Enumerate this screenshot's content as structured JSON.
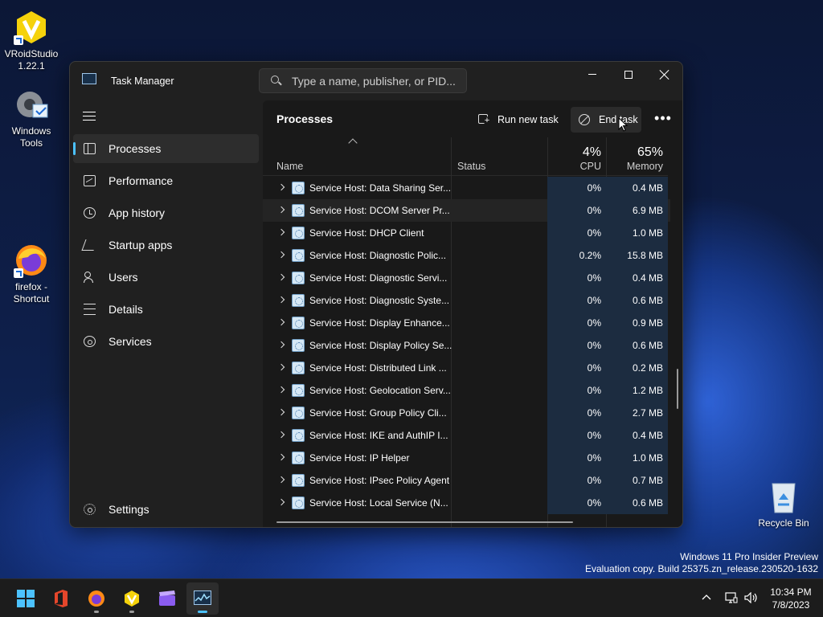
{
  "desktop": {
    "icons": [
      {
        "label": "VRoidStudio 1.22.1",
        "icon": "vroid-studio-icon"
      },
      {
        "label": "Windows Tools",
        "icon": "windows-tools-icon"
      },
      {
        "label": "firefox - Shortcut",
        "icon": "firefox-icon"
      },
      {
        "label": "Recycle Bin",
        "icon": "recycle-bin-icon"
      }
    ],
    "watermark_line1": "Windows 11 Pro Insider Preview",
    "watermark_line2": "Evaluation copy. Build 25375.zn_release.230520-1632"
  },
  "window": {
    "title": "Task Manager",
    "search_placeholder": "Type a name, publisher, or PID...",
    "controls": {
      "minimize": "minimize-icon",
      "maximize": "maximize-icon",
      "close": "close-icon"
    }
  },
  "sidebar": {
    "items": [
      {
        "label": "Processes",
        "icon": "processes-icon",
        "active": true
      },
      {
        "label": "Performance",
        "icon": "performance-icon"
      },
      {
        "label": "App history",
        "icon": "app-history-icon"
      },
      {
        "label": "Startup apps",
        "icon": "startup-apps-icon"
      },
      {
        "label": "Users",
        "icon": "users-icon"
      },
      {
        "label": "Details",
        "icon": "details-icon"
      },
      {
        "label": "Services",
        "icon": "services-icon"
      }
    ],
    "settings_label": "Settings"
  },
  "toolbar": {
    "title": "Processes",
    "run_new_task": "Run new task",
    "end_task": "End task",
    "more": "•••"
  },
  "table": {
    "columns": {
      "name": "Name",
      "status": "Status",
      "cpu": "CPU",
      "memory": "Memory"
    },
    "cpu_total": "4%",
    "memory_total": "65%",
    "rows": [
      {
        "name": "Service Host: Data Sharing Ser...",
        "status": "",
        "cpu": "0%",
        "memory": "0.4 MB"
      },
      {
        "name": "Service Host: DCOM Server Pr...",
        "status": "",
        "cpu": "0%",
        "memory": "6.9 MB"
      },
      {
        "name": "Service Host: DHCP Client",
        "status": "",
        "cpu": "0%",
        "memory": "1.0 MB"
      },
      {
        "name": "Service Host: Diagnostic Polic...",
        "status": "",
        "cpu": "0.2%",
        "memory": "15.8 MB"
      },
      {
        "name": "Service Host: Diagnostic Servi...",
        "status": "",
        "cpu": "0%",
        "memory": "0.4 MB"
      },
      {
        "name": "Service Host: Diagnostic Syste...",
        "status": "",
        "cpu": "0%",
        "memory": "0.6 MB"
      },
      {
        "name": "Service Host: Display Enhance...",
        "status": "",
        "cpu": "0%",
        "memory": "0.9 MB"
      },
      {
        "name": "Service Host: Display Policy Se...",
        "status": "",
        "cpu": "0%",
        "memory": "0.6 MB"
      },
      {
        "name": "Service Host: Distributed Link ...",
        "status": "",
        "cpu": "0%",
        "memory": "0.2 MB"
      },
      {
        "name": "Service Host: Geolocation Serv...",
        "status": "",
        "cpu": "0%",
        "memory": "1.2 MB"
      },
      {
        "name": "Service Host: Group Policy Cli...",
        "status": "",
        "cpu": "0%",
        "memory": "2.7 MB"
      },
      {
        "name": "Service Host: IKE and AuthIP I...",
        "status": "",
        "cpu": "0%",
        "memory": "0.4 MB"
      },
      {
        "name": "Service Host: IP Helper",
        "status": "",
        "cpu": "0%",
        "memory": "1.0 MB"
      },
      {
        "name": "Service Host: IPsec Policy Agent",
        "status": "",
        "cpu": "0%",
        "memory": "0.7 MB"
      },
      {
        "name": "Service Host: Local Service (N...",
        "status": "",
        "cpu": "0%",
        "memory": "0.6 MB"
      }
    ]
  },
  "taskbar": {
    "apps": [
      "start-icon",
      "office-icon",
      "firefox-icon",
      "vroid-studio-icon",
      "clapperboard-icon",
      "task-manager-icon"
    ],
    "time": "10:34 PM",
    "date": "7/8/2023"
  },
  "colors": {
    "accent": "#4cc2ff",
    "highlight_col": "#1c2c40"
  }
}
